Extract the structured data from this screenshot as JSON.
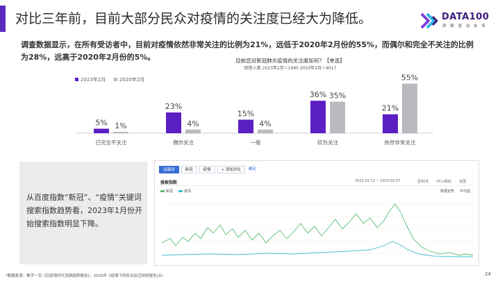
{
  "header": {
    "title": "对比三年前，目前大部分民众对疫情的关注度已经大为降低。",
    "logo_name": "DATA100",
    "logo_tagline": "洞 察 驱 动 未 来",
    "accent_color": "#5b2bbf"
  },
  "summary": "调查数据显示，在所有受访者中，目前对疫情依然非常关注的比例为21%，远低于2020年2月份的55%，而偶尔和完全不关注的比例为28%，远高于2020年2月份的5%。",
  "chart_data": {
    "type": "bar",
    "title": "目前您对新冠肺炎疫情的关注度如何？【单选】",
    "subtitle": "回答人数 2023年2月＝1990  2020年2月＝4017",
    "categories": [
      "已完全不关注",
      "偶尔关注",
      "一般",
      "较为关注",
      "依然非常关注"
    ],
    "series": [
      {
        "name": "2023年2月",
        "values": [
          5,
          23,
          15,
          36,
          21
        ],
        "color": "#5b1fc4"
      },
      {
        "name": "2020年2月",
        "values": [
          1,
          4,
          4,
          35,
          55
        ],
        "color": "#b8bac0"
      }
    ],
    "value_format": "percent",
    "ylim": [
      0,
      60
    ],
    "legend_position": "top-left",
    "grid": false
  },
  "panel": {
    "text": "从百度指数“新冠”、“疫情”关键词搜索指数趋势看，2023年1月份开始搜索指数明显下降。"
  },
  "baidu_index": {
    "keywords": [
      "关键词",
      "新冠",
      "疫情"
    ],
    "add_compare": "+ 添加对比",
    "confirm": "确定",
    "index_title": "搜索指数",
    "date_range": "2022-02-12 ~ 2023-02-07",
    "controls": [
      "近90天",
      "PC+移动",
      "全国"
    ],
    "legend": [
      "新冠",
      "疫情"
    ],
    "legend_right": [
      "数据走势",
      "平均值"
    ]
  },
  "footnote": "*数据来源：数字一百《后疫情时代消费趋势报告》，2020年《疫情下的民众反应特别报告(五)",
  "page_number": "24"
}
